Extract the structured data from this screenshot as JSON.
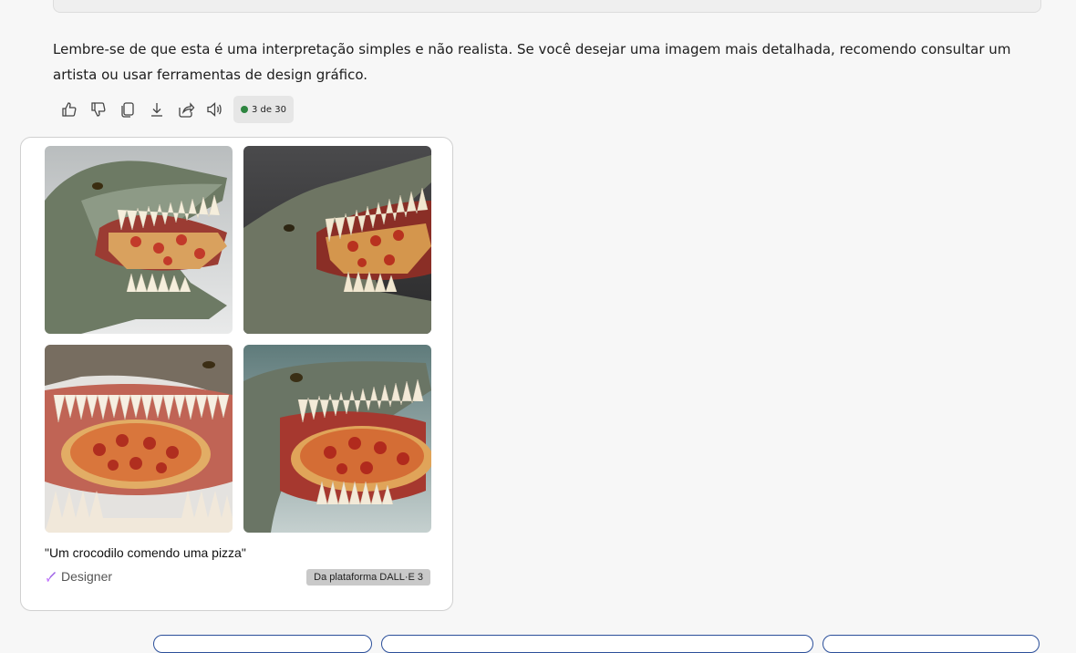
{
  "message": {
    "text": "Lembre-se de que esta é uma interpretação simples e não realista. Se você desejar uma imagem mais detalhada, recomendo consultar um artista ou usar ferramentas de design gráfico."
  },
  "actions": {
    "icons": [
      "thumbs-up-icon",
      "thumbs-down-icon",
      "copy-icon",
      "download-icon",
      "share-icon",
      "speaker-icon"
    ],
    "counter": "3 de 30",
    "counter_dot_color": "#2e8540"
  },
  "image_card": {
    "images": [
      {
        "subject": "crocodile-eating-pizza-1"
      },
      {
        "subject": "crocodile-eating-pizza-2"
      },
      {
        "subject": "crocodile-eating-pizza-3"
      },
      {
        "subject": "crocodile-eating-pizza-4"
      }
    ],
    "caption": "\"Um crocodilo comendo uma pizza\"",
    "designer_label": "Designer",
    "platform_badge": "Da plataforma DALL·E 3"
  },
  "colors": {
    "accent_border": "#2b4f9a",
    "designer_icon": "#9b5de5"
  }
}
